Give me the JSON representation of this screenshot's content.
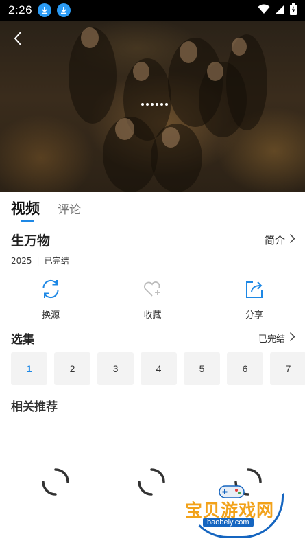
{
  "status_bar": {
    "time": "2:26",
    "icons": [
      "download-icon",
      "download-icon",
      "wifi-icon",
      "signal-icon",
      "battery-charging-icon"
    ]
  },
  "player": {
    "back_icon": "chevron-left-icon",
    "loading_indicator": "dots"
  },
  "tabs": [
    {
      "label": "视频",
      "active": true
    },
    {
      "label": "评论",
      "active": false
    }
  ],
  "show": {
    "title": "生万物",
    "intro_label": "简介",
    "year": "2025",
    "status": "已完结"
  },
  "actions": [
    {
      "label": "换源",
      "icon": "refresh-icon"
    },
    {
      "label": "收藏",
      "icon": "heart-add-icon"
    },
    {
      "label": "分享",
      "icon": "share-icon"
    }
  ],
  "episodes_section": {
    "title": "选集",
    "status_label": "已完结",
    "episodes": [
      "1",
      "2",
      "3",
      "4",
      "5",
      "6",
      "7"
    ],
    "selected": "1"
  },
  "related": {
    "title": "相关推荐"
  },
  "watermark": {
    "text": "宝贝游戏网",
    "url": "baobeiy.com"
  },
  "colors": {
    "accent": "#1e88e5",
    "episode_bg": "#f3f3f3",
    "watermark_orange": "#f2a21a",
    "watermark_blue": "#1565c0"
  }
}
